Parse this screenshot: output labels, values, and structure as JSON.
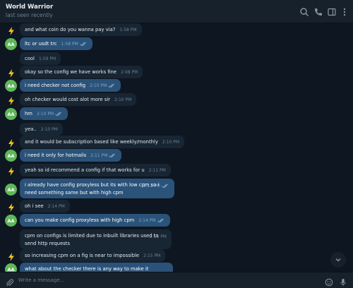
{
  "header": {
    "title": "World Warrior",
    "status": "last seen recently"
  },
  "icons": {
    "search": "search-icon",
    "call": "phone-icon",
    "sidebar": "sidebar-toggle-icon",
    "more": "more-vertical-icon",
    "attach": "paperclip-icon",
    "emoji": "emoji-icon",
    "voice": "microphone-icon",
    "scroll_down": "chevron-down-icon",
    "contact_avatar": "lightning-icon"
  },
  "colors": {
    "background": "#0e1621",
    "incoming_bubble": "#182533",
    "outgoing_bubble": "#2b5278",
    "avatar_green": "#5fb75a",
    "lightning_yellow": "#f2c318"
  },
  "messages": [
    {
      "author": "them",
      "avatar": "",
      "text": "and what coin do you wanna pay via?",
      "time": "1:58 PM",
      "read": false
    },
    {
      "author": "me",
      "avatar": "AA",
      "text": "ltc or usdt trc",
      "time": "1:58 PM",
      "read": true
    },
    {
      "author": "them",
      "avatar": "",
      "text": "cool",
      "time": "1:59 PM",
      "read": false
    },
    {
      "author": "them",
      "avatar": "",
      "text": "okay so the config we have works fine",
      "time": "2:08 PM",
      "read": false
    },
    {
      "author": "me",
      "avatar": "AA",
      "text": "i need checker not config",
      "time": "2:10 PM",
      "read": true
    },
    {
      "author": "them",
      "avatar": "",
      "text": "oh checker would cost alot more sir",
      "time": "2:10 PM",
      "read": false
    },
    {
      "author": "me",
      "avatar": "AA",
      "text": "hm",
      "time": "2:10 PM",
      "read": true
    },
    {
      "author": "them",
      "avatar": "",
      "text": "yea..",
      "time": "2:10 PM",
      "read": false
    },
    {
      "author": "them",
      "avatar": "",
      "text": "and it would be subscription based like weekly/monthly",
      "time": "2:10 PM",
      "read": false
    },
    {
      "author": "me",
      "avatar": "AA",
      "text": "i need it only for hotmails",
      "time": "2:11 PM",
      "read": true
    },
    {
      "author": "them",
      "avatar": "",
      "text": "yeah so id recommend a config if that works for u",
      "time": "2:11 PM",
      "read": false
    },
    {
      "author": "me",
      "avatar": "AA",
      "text": "i already have config proxyless but its with low cpm so i need something same but with high cpm",
      "time": "2:12 PM",
      "read": true
    },
    {
      "author": "them",
      "avatar": "",
      "text": "oh i see",
      "time": "2:14 PM",
      "read": false
    },
    {
      "author": "me",
      "avatar": "AA",
      "text": "can you make config proxyless with high cpm",
      "time": "2:14 PM",
      "read": true
    },
    {
      "author": "them",
      "avatar": "",
      "text": "cpm on configs is limited due to inbuilt libraries used to send http requests",
      "time": "2:15 PM",
      "read": false
    },
    {
      "author": "them",
      "avatar": "",
      "text": "so increasing cpm on a fig is near to impossible",
      "time": "2:15 PM",
      "read": false
    },
    {
      "author": "me",
      "avatar": "AA",
      "text": "what about the checker there is any way to make it without",
      "time": "",
      "read": false
    }
  ],
  "composer": {
    "placeholder": "Write a message..."
  }
}
